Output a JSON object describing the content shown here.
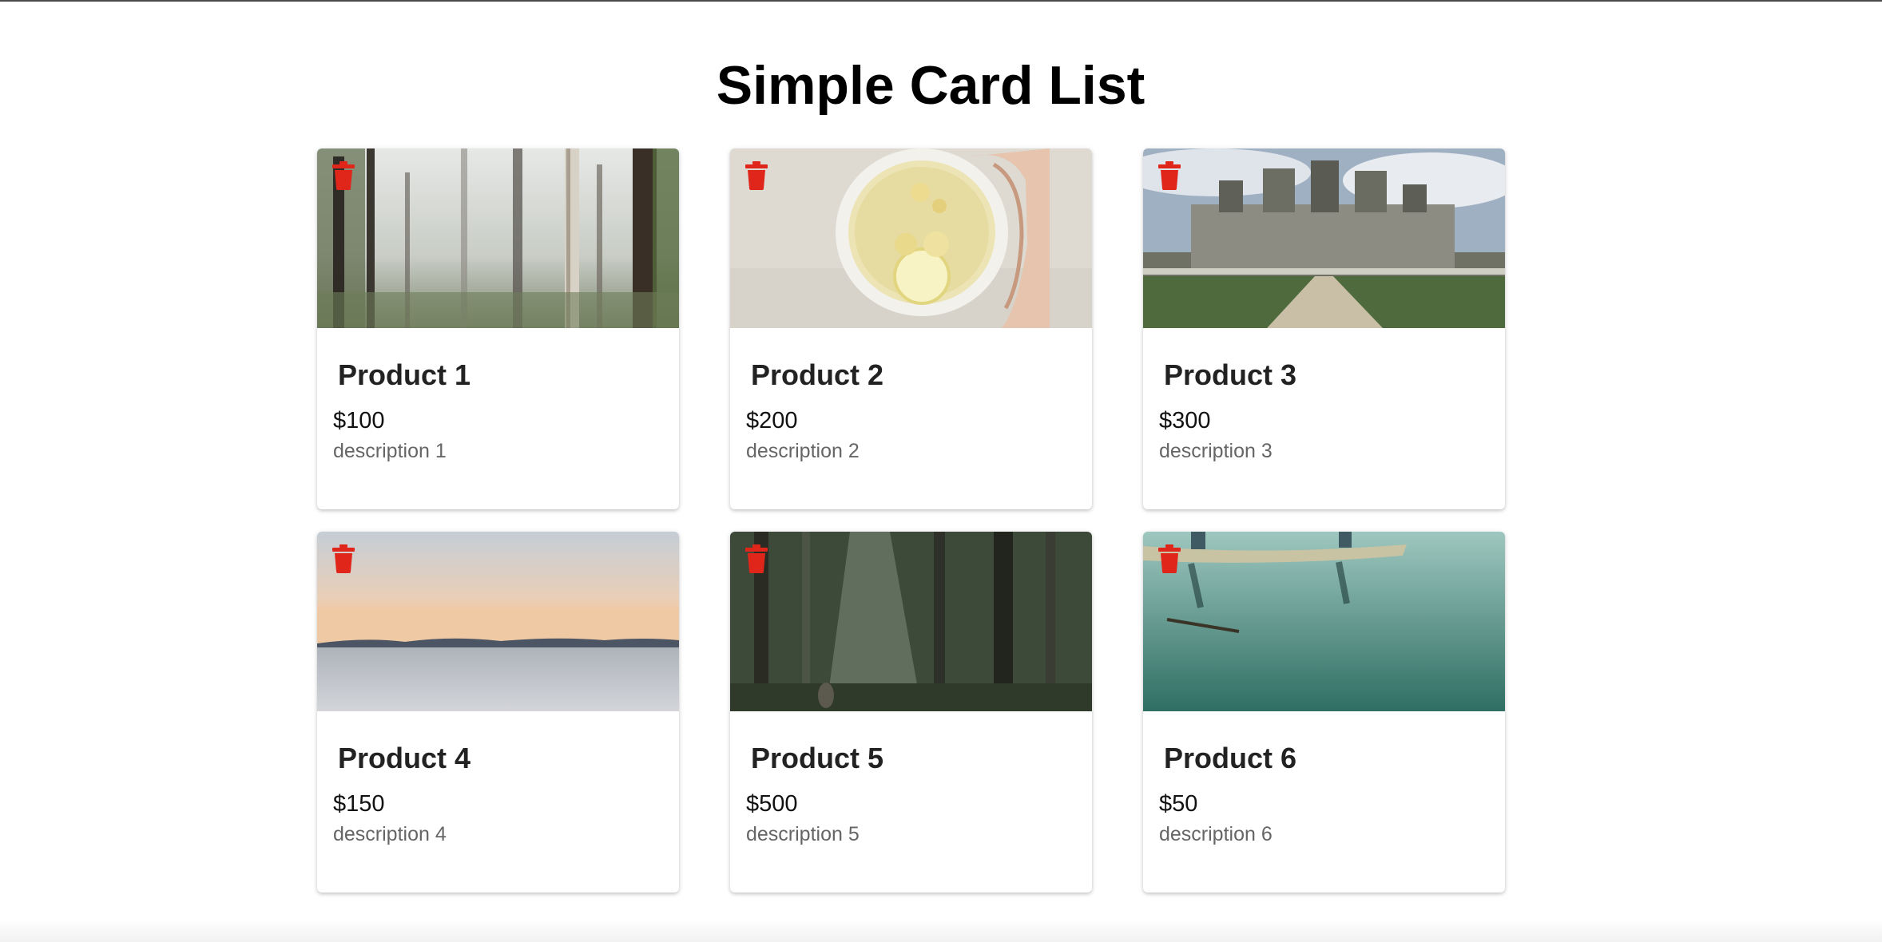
{
  "page": {
    "title": "Simple Card List"
  },
  "accent": {
    "delete_icon_color": "#e0251b"
  },
  "cards": [
    {
      "title": "Product 1",
      "price": "$100",
      "description": "description 1",
      "image": "misty-forest-photo",
      "delete_icon": "trash-icon"
    },
    {
      "title": "Product 2",
      "price": "$200",
      "description": "description 2",
      "image": "lemon-tea-cup-photo",
      "delete_icon": "trash-icon"
    },
    {
      "title": "Product 3",
      "price": "$300",
      "description": "description 3",
      "image": "chateau-photo",
      "delete_icon": "trash-icon"
    },
    {
      "title": "Product 4",
      "price": "$150",
      "description": "description 4",
      "image": "lake-sunset-photo",
      "delete_icon": "trash-icon"
    },
    {
      "title": "Product 5",
      "price": "$500",
      "description": "description 5",
      "image": "dark-forest-photo",
      "delete_icon": "trash-icon"
    },
    {
      "title": "Product 6",
      "price": "$50",
      "description": "description 6",
      "image": "canoe-lake-photo",
      "delete_icon": "trash-icon"
    }
  ]
}
